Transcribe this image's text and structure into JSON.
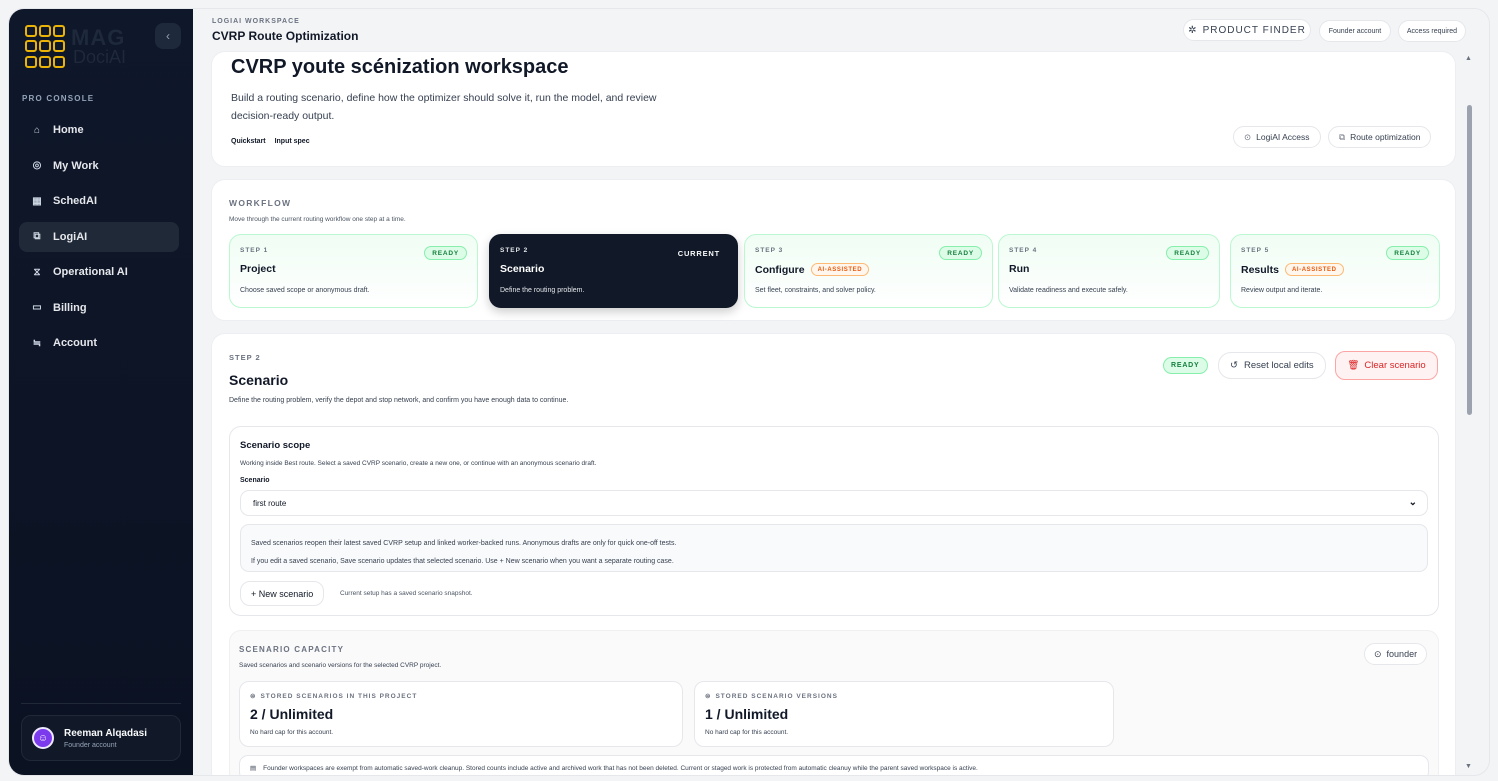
{
  "sidebar": {
    "logo_text_1": "MAG",
    "logo_text_2": "DociAI",
    "collapse_icon": "‹",
    "section_label": "PRO CONSOLE",
    "items": [
      {
        "icon": "⌂",
        "label": "Home"
      },
      {
        "icon": "◎",
        "label": "My Work"
      },
      {
        "icon": "▦",
        "label": "SchedAI"
      },
      {
        "icon": "⧉",
        "label": "LogiAI",
        "active": true
      },
      {
        "icon": "⧖",
        "label": "Operational AI"
      },
      {
        "icon": "▭",
        "label": "Billing"
      },
      {
        "icon": "≒",
        "label": "Account"
      }
    ],
    "user": {
      "initial": "☺",
      "name": "Reeman Alqadasi",
      "role": "Founder account"
    }
  },
  "header": {
    "workspace_label": "LOGIAI WORKSPACE",
    "title": "CVRP Route Optimization",
    "product_finder": "PRODUCT FINDER",
    "founder_account": "Founder account",
    "access_required": "Access required"
  },
  "hero": {
    "title": "CVRP youte scénization workspace",
    "description": "Build a routing scenario, define how the optimizer should solve it, run the model, and review decision-ready output.",
    "tabs": [
      "Quickstart",
      "Input spec"
    ],
    "pill_access": "LogiAI Access",
    "pill_route": "Route optimization"
  },
  "workflow": {
    "label": "WORKFLOW",
    "description": "Move through the current routing workflow one step at a time.",
    "steps": [
      {
        "num": "STEP 1",
        "badge": "READY",
        "title": "Project",
        "ai": "",
        "desc": "Choose saved scope or anonymous draft."
      },
      {
        "num": "STEP 2",
        "badge": "CURRENT",
        "title": "Scenario",
        "ai": "",
        "desc": "Define the routing problem."
      },
      {
        "num": "STEP 3",
        "badge": "READY",
        "title": "Configure",
        "ai": "AI-ASSISTED",
        "desc": "Set fleet, constraints, and solver policy."
      },
      {
        "num": "STEP 4",
        "badge": "READY",
        "title": "Run",
        "ai": "",
        "desc": "Validate readiness and execute safely."
      },
      {
        "num": "STEP 5",
        "badge": "READY",
        "title": "Results",
        "ai": "AI-ASSISTED",
        "desc": "Review output and iterate."
      }
    ]
  },
  "scenario": {
    "step": "STEP 2",
    "title": "Scenario",
    "description": "Define the routing problem, verify the depot and stop network, and confirm you have enough data to continue.",
    "ready": "READY",
    "reset": "Reset local edits",
    "clear": "Clear scenario",
    "scope": {
      "title": "Scenario scope",
      "description": "Working inside Best route. Select a saved CVRP scenario, create a new one, or continue with an anonymous scenario draft.",
      "select_label": "Scenario",
      "select_value": "first route",
      "notice_1": "Saved scenarios reopen their latest saved CVRP setup and linked worker-backed runs. Anonymous drafts are only for quick one-off tests.",
      "notice_2": "If you edit a saved scenario, Save scenario updates that selected scenario. Use + New scenario when you want a separate routing case.",
      "new_button": "+ New scenario",
      "new_note": "Current setup has a saved scenario snapshot."
    },
    "capacity": {
      "label": "SCENARIO CAPACITY",
      "description": "Saved scenarios and scenario versions for the selected CVRP project.",
      "founder": "founder",
      "stats": [
        {
          "label": "STORED SCENARIOS IN THIS PROJECT",
          "value": "2 / Unlimited",
          "note": "No hard cap for this account."
        },
        {
          "label": "STORED SCENARIO VERSIONS",
          "value": "1 / Unlimited",
          "note": "No hard cap for this account."
        }
      ],
      "footer": "Founder workspaces are exempt from automatic saved-work cleanup. Stored counts include active and archived work that has not been deleted. Current or staged work is protected from automatic cleanuy while the parent saved workspace is active."
    }
  }
}
